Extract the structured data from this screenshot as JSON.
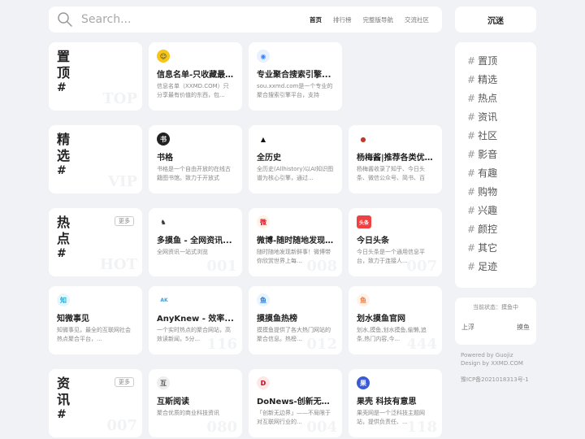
{
  "search": {
    "placeholder": "Search..."
  },
  "top_nav": [
    "首页",
    "排行榜",
    "完整版导航",
    "交流社区"
  ],
  "sidebar": {
    "title": "沉迷",
    "items": [
      "置顶",
      "精选",
      "热点",
      "资讯",
      "社区",
      "影音",
      "有趣",
      "购物",
      "兴趣",
      "颜控",
      "其它",
      "足迹"
    ],
    "status_text": "当前状态：摸鱼中",
    "left_action": "上浮",
    "right_action": "摸鱼"
  },
  "footer": {
    "powered": "Powered by Guojiz",
    "design": "Design by XXMD.COM",
    "icp": "豫ICP备2021018313号-1"
  },
  "sections": [
    {
      "title": "置顶",
      "hash": "#",
      "more": "",
      "wm": "TOP"
    },
    {
      "title": "精选",
      "hash": "#",
      "more": "",
      "wm": "VIP"
    },
    {
      "title": "热点",
      "hash": "#",
      "more": "更多",
      "wm": "HOT"
    },
    {
      "title": "资讯",
      "hash": "#",
      "more": "更多",
      "wm": "007"
    }
  ],
  "cards": [
    {
      "name": "信息名单-只收藏最...",
      "desc": "信息名单（XXMD.COM）只分享最有价值的东西，包...",
      "logo": "☺",
      "logo_bg": "#f5c518",
      "logo_fg": "#333",
      "wm": ""
    },
    {
      "name": "专业聚合搜索引擎...",
      "desc": "sou.xxmd.com是一个专业的聚合搜索引擎平台，支持",
      "logo": "◉",
      "logo_bg": "#e8f1ff",
      "logo_fg": "#3b82f6",
      "wm": ""
    },
    {
      "name": "书格",
      "desc": "书格是一个自由开放的在线古籍图书馆。致力于开放式",
      "logo": "书",
      "logo_bg": "#222",
      "logo_fg": "#fff",
      "wm": ""
    },
    {
      "name": "全历史",
      "desc": "全历史(Allhistory)以AI知识图谱为核心引擎，通过...",
      "logo": "▲",
      "logo_bg": "#fff",
      "logo_fg": "#111",
      "wm": ""
    },
    {
      "name": "杨梅酱|推荐各类优...",
      "desc": "杨梅酱收录了知乎、今日头条、微信公众号、简书、百",
      "logo": "●",
      "logo_bg": "#fff",
      "logo_fg": "#c0392b",
      "wm": ""
    },
    {
      "name": "多摸鱼 - 全网资讯...",
      "desc": "全网资讯一站式浏览",
      "logo": "♞",
      "logo_bg": "#fff",
      "logo_fg": "#333",
      "wm": "001"
    },
    {
      "name": "微博-随时随地发现...",
      "desc": "随时随地发现新鲜事！微博带你欣赏世界上每...",
      "logo": "微",
      "logo_bg": "#fff1e6",
      "logo_fg": "#e6162d",
      "wm": "008"
    },
    {
      "name": "今日头条",
      "desc": "今日头条是一个通用信息平台，致力于连接人...",
      "logo": "头条",
      "logo_bg": "#f04142",
      "logo_fg": "#fff",
      "wm": "007"
    },
    {
      "name": "知微事见",
      "desc": "知微事见，最全的互联网社会热点聚合平台，...",
      "logo": "知",
      "logo_bg": "#e6f7fb",
      "logo_fg": "#28a8d8",
      "wm": ""
    },
    {
      "name": "AnyKnew - 效率...",
      "desc": "一个实时热点的聚合网站，高效读新闻，5分...",
      "logo": "AK",
      "logo_bg": "#fff",
      "logo_fg": "#3aa0d8",
      "wm": "116"
    },
    {
      "name": "摸摸鱼热榜",
      "desc": "摸摸鱼提供了各大热门网站的聚合信息。热榜...",
      "logo": "鱼",
      "logo_bg": "#e8f4ff",
      "logo_fg": "#2b7bd6",
      "wm": "012"
    },
    {
      "name": "划水摸鱼官网",
      "desc": "划水,摸鱼,划水摸鱼,偷懒,追条,热门内容,今...",
      "logo": "鱼",
      "logo_bg": "#fff2ea",
      "logo_fg": "#f07a3a",
      "wm": "444"
    },
    {
      "name": "互斯阅读",
      "desc": "聚合优质的商业科技资讯",
      "logo": "互",
      "logo_bg": "#eee",
      "logo_fg": "#555",
      "wm": "080"
    },
    {
      "name": "DoNews-创新无边...",
      "desc": "「创新无边界」——不局限于对互联网行业的...",
      "logo": "D",
      "logo_bg": "#fde8e8",
      "logo_fg": "#d0021b",
      "wm": "004"
    },
    {
      "name": "果壳 科技有意思",
      "desc": "果壳网是一个泛科技主题网站，提供负责任、...",
      "logo": "果",
      "logo_bg": "#3b5bd6",
      "logo_fg": "#fff",
      "wm": "118"
    }
  ]
}
